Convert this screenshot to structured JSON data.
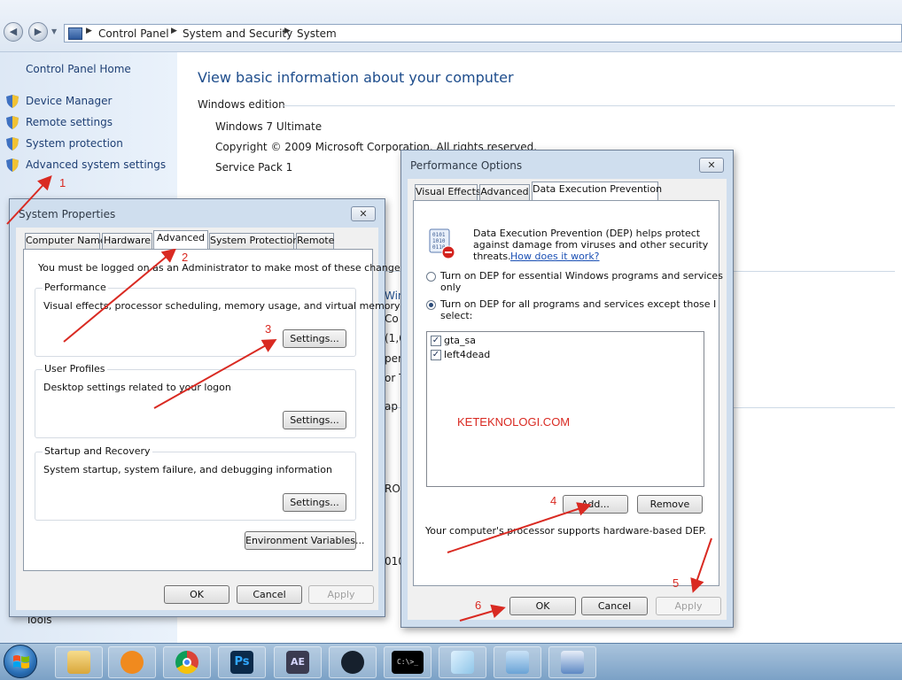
{
  "address_bar": {
    "crumbs": [
      "Control Panel",
      "System and Security",
      "System"
    ]
  },
  "left_pane": {
    "home": "Control Panel Home",
    "links": [
      "Device Manager",
      "Remote settings",
      "System protection",
      "Advanced system settings"
    ],
    "tools": "Tools"
  },
  "main": {
    "heading": "View basic information about your computer",
    "edition_label": "Windows edition",
    "edition": "Windows 7 Ultimate",
    "copyright": "Copyright © 2009 Microsoft Corporation.  All rights reserved.",
    "service_pack": "Service Pack 1",
    "partial": [
      "Win",
      "Co",
      "(1,6",
      "per",
      "or T",
      "ap s",
      "RO",
      "010"
    ]
  },
  "system_properties": {
    "title": "System Properties",
    "close": "✕",
    "tabs": [
      "Computer Name",
      "Hardware",
      "Advanced",
      "System Protection",
      "Remote"
    ],
    "admin_note": "You must be logged on as an Administrator to make most of these changes.",
    "performance": {
      "label": "Performance",
      "desc": "Visual effects, processor scheduling, memory usage, and virtual memory",
      "button": "Settings..."
    },
    "user_profiles": {
      "label": "User Profiles",
      "desc": "Desktop settings related to your logon",
      "button": "Settings..."
    },
    "startup": {
      "label": "Startup and Recovery",
      "desc": "System startup, system failure, and debugging information",
      "button": "Settings..."
    },
    "env_button": "Environment Variables...",
    "ok": "OK",
    "cancel": "Cancel",
    "apply": "Apply"
  },
  "performance_options": {
    "title": "Performance Options",
    "close": "✕",
    "tabs": [
      "Visual Effects",
      "Advanced",
      "Data Execution Prevention"
    ],
    "dep_desc_1": "Data Execution Prevention (DEP) helps protect",
    "dep_desc_2": "against damage from viruses and other security",
    "dep_desc_3": "threats.",
    "how_link": "How does it work?",
    "radio1_line1": "Turn on DEP for essential Windows programs and services",
    "radio1_line2": "only",
    "radio2_line1": "Turn on DEP for all programs and services except those I",
    "radio2_line2": "select:",
    "programs": [
      "gta_sa",
      "left4dead"
    ],
    "watermark": "KETEKNOLOGI.COM",
    "add": "Add...",
    "remove": "Remove",
    "support_note": "Your computer's processor supports hardware-based DEP.",
    "ok": "OK",
    "cancel": "Cancel",
    "apply": "Apply"
  },
  "annotations": [
    "1",
    "2",
    "3",
    "4",
    "5",
    "6"
  ],
  "taskbar": {
    "ps_label": "Ps",
    "ae_label": "AE",
    "cmd_label": "C:\\>_"
  },
  "colors": {
    "annotation": "#d92a22",
    "link": "#1e3f74",
    "heading": "#1e4d8c"
  }
}
